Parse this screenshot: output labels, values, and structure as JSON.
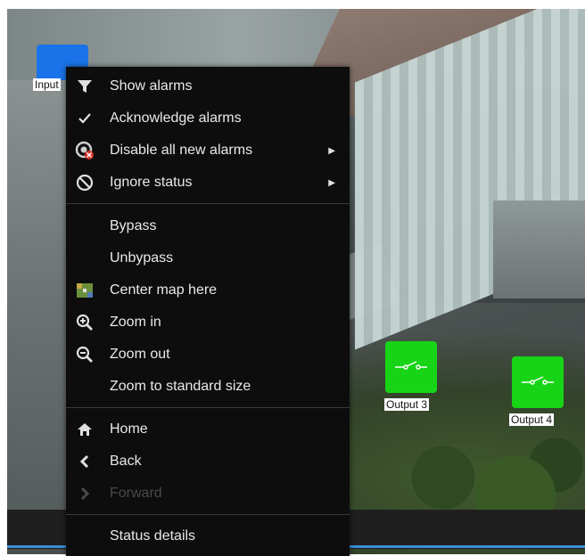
{
  "map": {
    "devices": [
      {
        "id": "input",
        "label": "Input"
      },
      {
        "id": "output3",
        "label": "Output 3"
      },
      {
        "id": "output4",
        "label": "Output 4"
      }
    ]
  },
  "context_menu": {
    "group1": [
      {
        "label": "Show alarms",
        "icon": "filter-icon"
      },
      {
        "label": "Acknowledge alarms",
        "icon": "checkmark-icon"
      },
      {
        "label": "Disable all new alarms",
        "icon": "alarm-disable-icon",
        "submenu": true
      },
      {
        "label": "Ignore status",
        "icon": "no-entry-icon",
        "submenu": true
      }
    ],
    "group2": [
      {
        "label": "Bypass"
      },
      {
        "label": "Unbypass"
      },
      {
        "label": "Center map here",
        "icon": "map-center-icon"
      },
      {
        "label": "Zoom in",
        "icon": "zoom-in-icon"
      },
      {
        "label": "Zoom out",
        "icon": "zoom-out-icon"
      },
      {
        "label": "Zoom to standard size"
      }
    ],
    "group3": [
      {
        "label": "Home",
        "icon": "home-icon"
      },
      {
        "label": "Back",
        "icon": "chevron-left-icon"
      },
      {
        "label": "Forward",
        "icon": "chevron-right-icon",
        "disabled": true
      }
    ],
    "group4": [
      {
        "label": "Status details"
      }
    ]
  },
  "colors": {
    "menu_bg": "#0d0d0d",
    "output_green": "#17d417",
    "input_blue": "#1a73e8",
    "accent_line": "#3b8fd6"
  }
}
